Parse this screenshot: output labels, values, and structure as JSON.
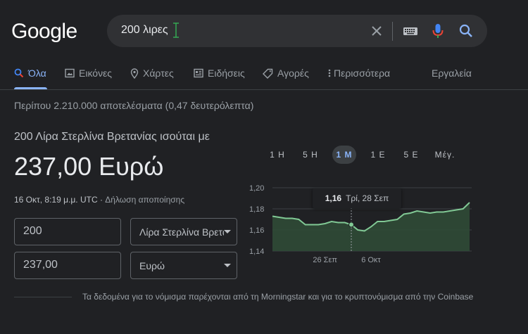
{
  "logo": "Google",
  "search": {
    "query": "200 λιρες"
  },
  "tabs": [
    {
      "label": "Όλα",
      "icon": "search-icon"
    },
    {
      "label": "Εικόνες",
      "icon": "image-icon"
    },
    {
      "label": "Χάρτες",
      "icon": "map-pin-icon"
    },
    {
      "label": "Ειδήσεις",
      "icon": "news-icon"
    },
    {
      "label": "Αγορές",
      "icon": "tag-icon"
    },
    {
      "label": "Περισσότερα",
      "icon": "more-vert-icon"
    }
  ],
  "tools_label": "Εργαλεία",
  "results_count": "Περίπου 2.210.000 αποτελέσματα (0,47 δευτερόλεπτα)",
  "converter": {
    "heading": "200 Λίρα Στερλίνα Βρετανίας ισούται με",
    "result": "237,00 Ευρώ",
    "timestamp": "16 Οκτ, 8:19 μ.μ. UTC ·",
    "disclaimer_link": "Δήλωση αποποίησης",
    "from_amount": "200",
    "from_currency": "Λίρα Στερλίνα Βρετανίας",
    "to_amount": "237,00",
    "to_currency": "Ευρώ"
  },
  "ranges": [
    "1 Η",
    "5 Η",
    "1 Μ",
    "1 Ε",
    "5 Ε",
    "Μέγ."
  ],
  "active_range": "1 Μ",
  "tooltip": {
    "value": "1,16",
    "date": "Τρί, 28 Σεπ"
  },
  "footer_note": "Τα δεδομένα για το νόμισμα παρέχονται από τη Morningstar και για το κρυπτονόμισμα από την Coinbase",
  "colors": {
    "accent": "#8ab4f8",
    "line": "#81c995",
    "area": "#2f4a36",
    "background": "#202124"
  },
  "chart_data": {
    "type": "area",
    "y_ticks": [
      "1,20",
      "1,18",
      "1,16",
      "1,14"
    ],
    "ylim": [
      1.14,
      1.2
    ],
    "x_ticks": [
      {
        "label": "26 Σεπ",
        "index": 8
      },
      {
        "label": "6 Οκτ",
        "index": 15
      }
    ],
    "values": [
      1.173,
      1.172,
      1.171,
      1.171,
      1.17,
      1.165,
      1.165,
      1.165,
      1.166,
      1.168,
      1.167,
      1.167,
      1.165,
      1.16,
      1.159,
      1.163,
      1.168,
      1.168,
      1.169,
      1.17,
      1.175,
      1.176,
      1.178,
      1.177,
      1.176,
      1.177,
      1.177,
      1.178,
      1.179,
      1.18,
      1.186
    ],
    "highlight_index": 12
  }
}
